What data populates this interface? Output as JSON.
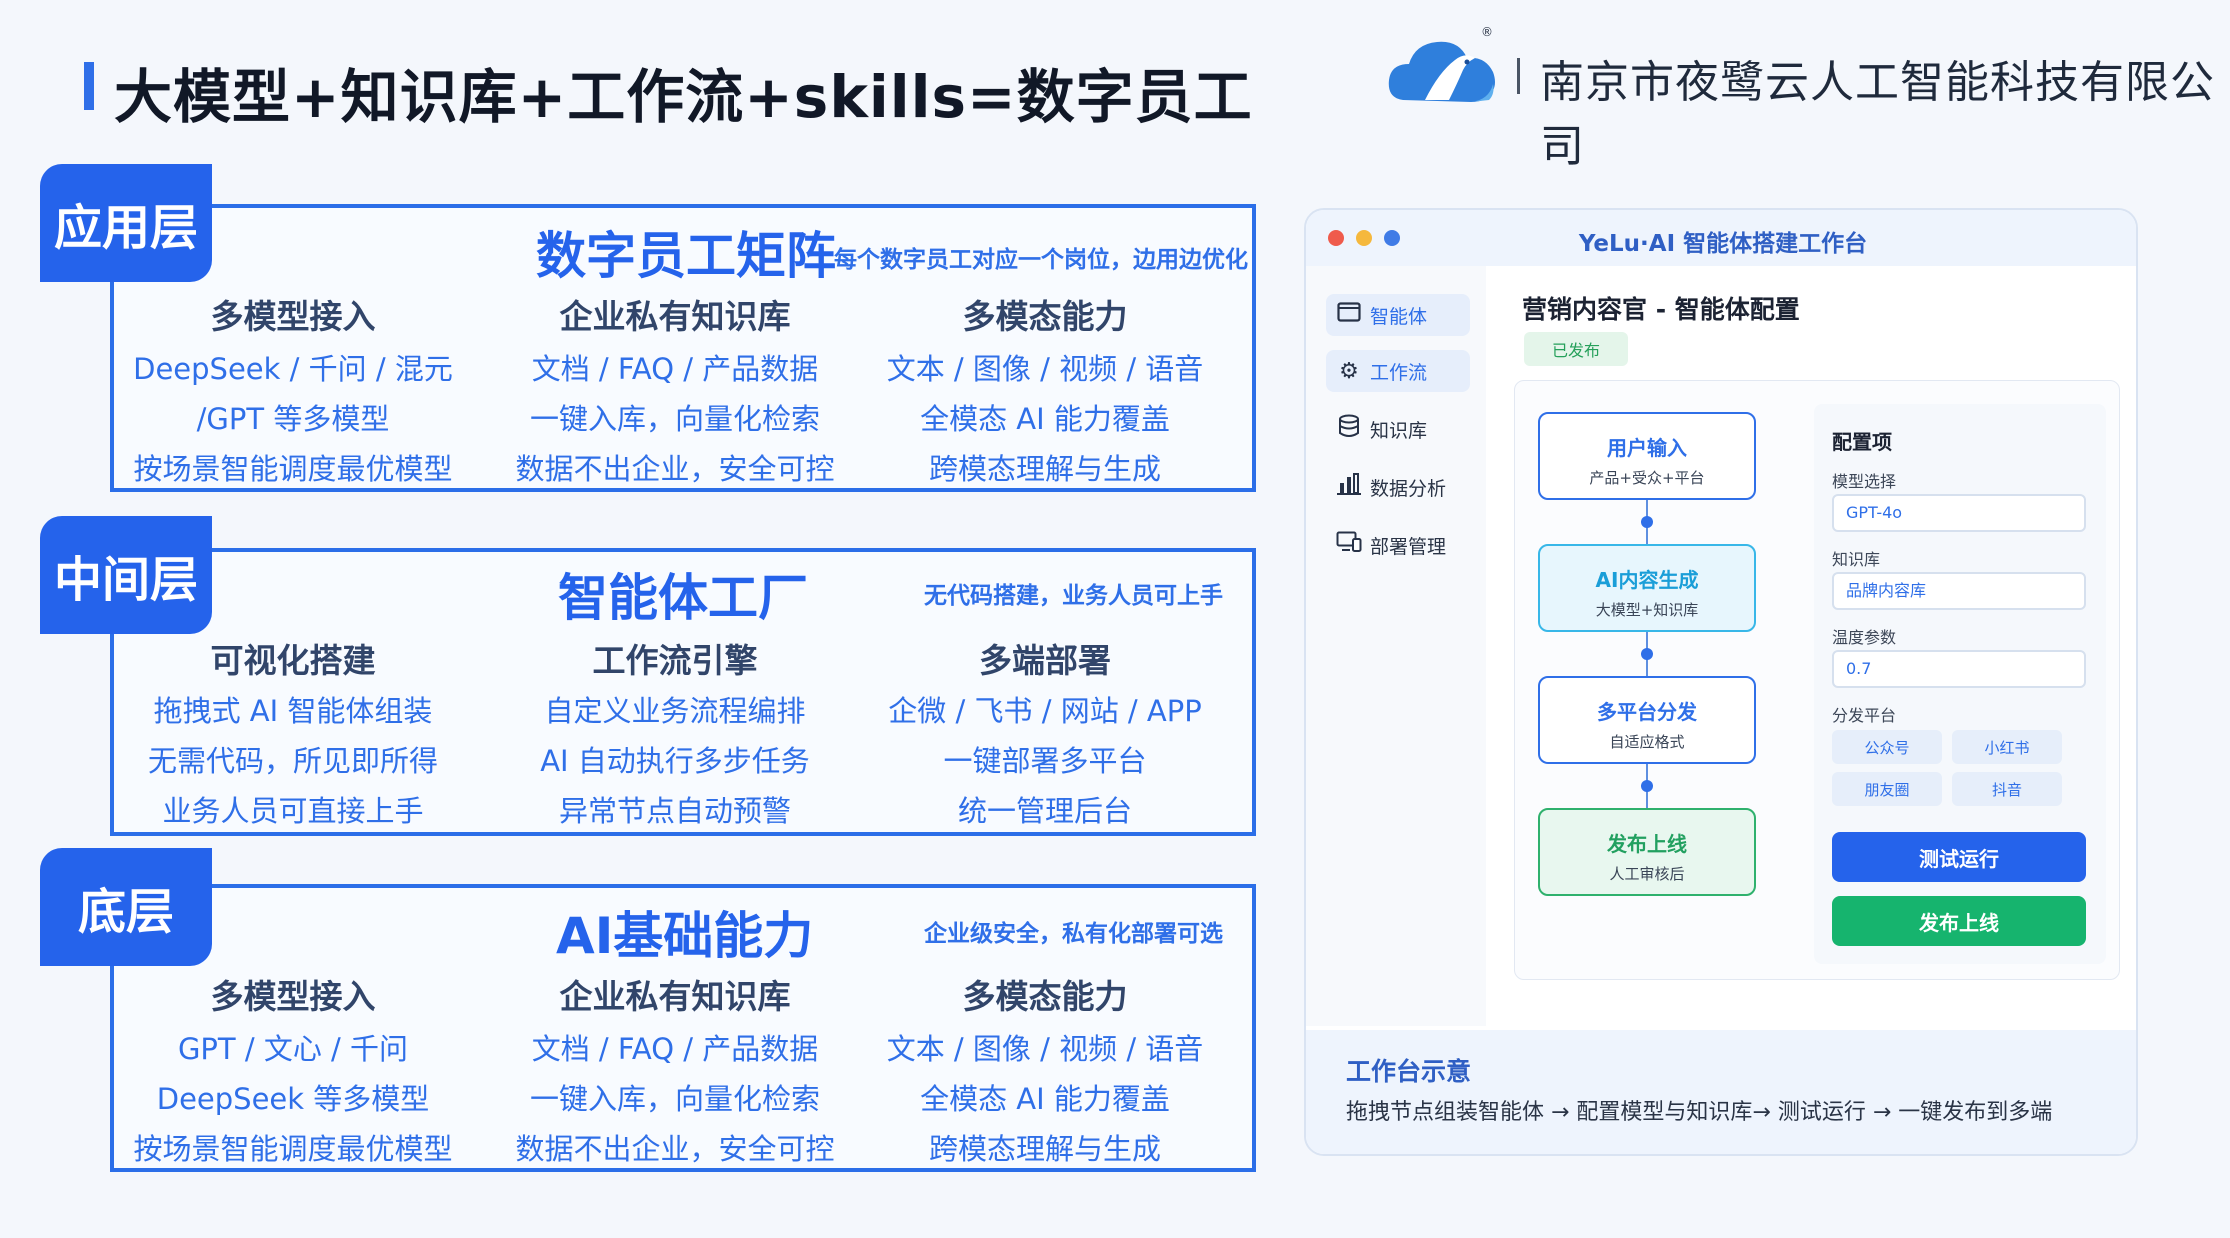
{
  "header": {
    "title": "大模型+知识库+工作流+skills=数字员工",
    "company": "南京市夜鹭云人工智能科技有限公司",
    "logo_icon": "cloud-heron-logo-icon"
  },
  "layers": [
    {
      "tag": "应用层",
      "title": "数字员工矩阵",
      "subtitle": "每个数字员工对应一个岗位，边用边优化",
      "columns": [
        {
          "heading": "多模型接入",
          "lines": [
            "DeepSeek / 千问 / 混元",
            "/GPT 等多模型",
            "按场景智能调度最优模型"
          ]
        },
        {
          "heading": "企业私有知识库",
          "lines": [
            "文档 / FAQ / 产品数据",
            "一键入库，向量化检索",
            "数据不出企业，安全可控"
          ]
        },
        {
          "heading": "多模态能力",
          "lines": [
            "文本 / 图像 / 视频 / 语音",
            "全模态 AI 能力覆盖",
            "跨模态理解与生成"
          ]
        }
      ]
    },
    {
      "tag": "中间层",
      "title": "智能体工厂",
      "subtitle": "无代码搭建，业务人员可上手",
      "columns": [
        {
          "heading": "可视化搭建",
          "lines": [
            "拖拽式 AI 智能体组装",
            "无需代码，所见即所得",
            "业务人员可直接上手"
          ]
        },
        {
          "heading": "工作流引擎",
          "lines": [
            "自定义业务流程编排",
            "AI 自动执行多步任务",
            "异常节点自动预警"
          ]
        },
        {
          "heading": "多端部署",
          "lines": [
            "企微 / 飞书 / 网站 / APP",
            "一键部署多平台",
            "统一管理后台"
          ]
        }
      ]
    },
    {
      "tag": "底层",
      "title": "AI基础能力",
      "subtitle": "企业级安全，私有化部署可选",
      "columns": [
        {
          "heading": "多模型接入",
          "lines": [
            "GPT / 文心 / 千问",
            "DeepSeek 等多模型",
            "按场景智能调度最优模型"
          ]
        },
        {
          "heading": "企业私有知识库",
          "lines": [
            "文档 / FAQ / 产品数据",
            "一键入库，向量化检索",
            "数据不出企业，安全可控"
          ]
        },
        {
          "heading": "多模态能力",
          "lines": [
            "文本 / 图像 / 视频 / 语音",
            "全模态 AI 能力覆盖",
            "跨模态理解与生成"
          ]
        }
      ]
    }
  ],
  "workbench": {
    "window_title": "YeLu·AI 智能体搭建工作台",
    "window_dots": [
      "#ef5b4c",
      "#f5b83d",
      "#3f7be6"
    ],
    "sidebar": [
      {
        "label": "智能体",
        "icon": "agent-window-icon",
        "active": true
      },
      {
        "label": "工作流",
        "icon": "gear-icon",
        "active": true
      },
      {
        "label": "知识库",
        "icon": "database-icon",
        "active": false
      },
      {
        "label": "数据分析",
        "icon": "bar-chart-icon",
        "active": false
      },
      {
        "label": "部署管理",
        "icon": "devices-icon",
        "active": false
      }
    ],
    "page_title": "营销内容官 - 智能体配置",
    "status_badge": "已发布",
    "flow_nodes": [
      {
        "title": "用户输入",
        "desc": "产品+受众+平台"
      },
      {
        "title": "AI内容生成",
        "desc": "大模型+知识库"
      },
      {
        "title": "多平台分发",
        "desc": "自适应格式"
      },
      {
        "title": "发布上线",
        "desc": "人工审核后"
      }
    ],
    "config": {
      "heading": "配置项",
      "model_label": "模型选择",
      "model_value": "GPT-4o",
      "kb_label": "知识库",
      "kb_value": "品牌内容库",
      "temp_label": "温度参数",
      "temp_value": "0.7",
      "platform_label": "分发平台",
      "platforms": [
        "公众号",
        "小红书",
        "朋友圈",
        "抖音"
      ],
      "test_button": "测试运行",
      "publish_button": "发布上线",
      "test_color": "#2563eb",
      "publish_color": "#16b46e"
    },
    "footer": {
      "heading": "工作台示意",
      "text": "拖拽节点组装智能体 → 配置模型与知识库→ 测试运行 → 一键发布到多端"
    }
  }
}
